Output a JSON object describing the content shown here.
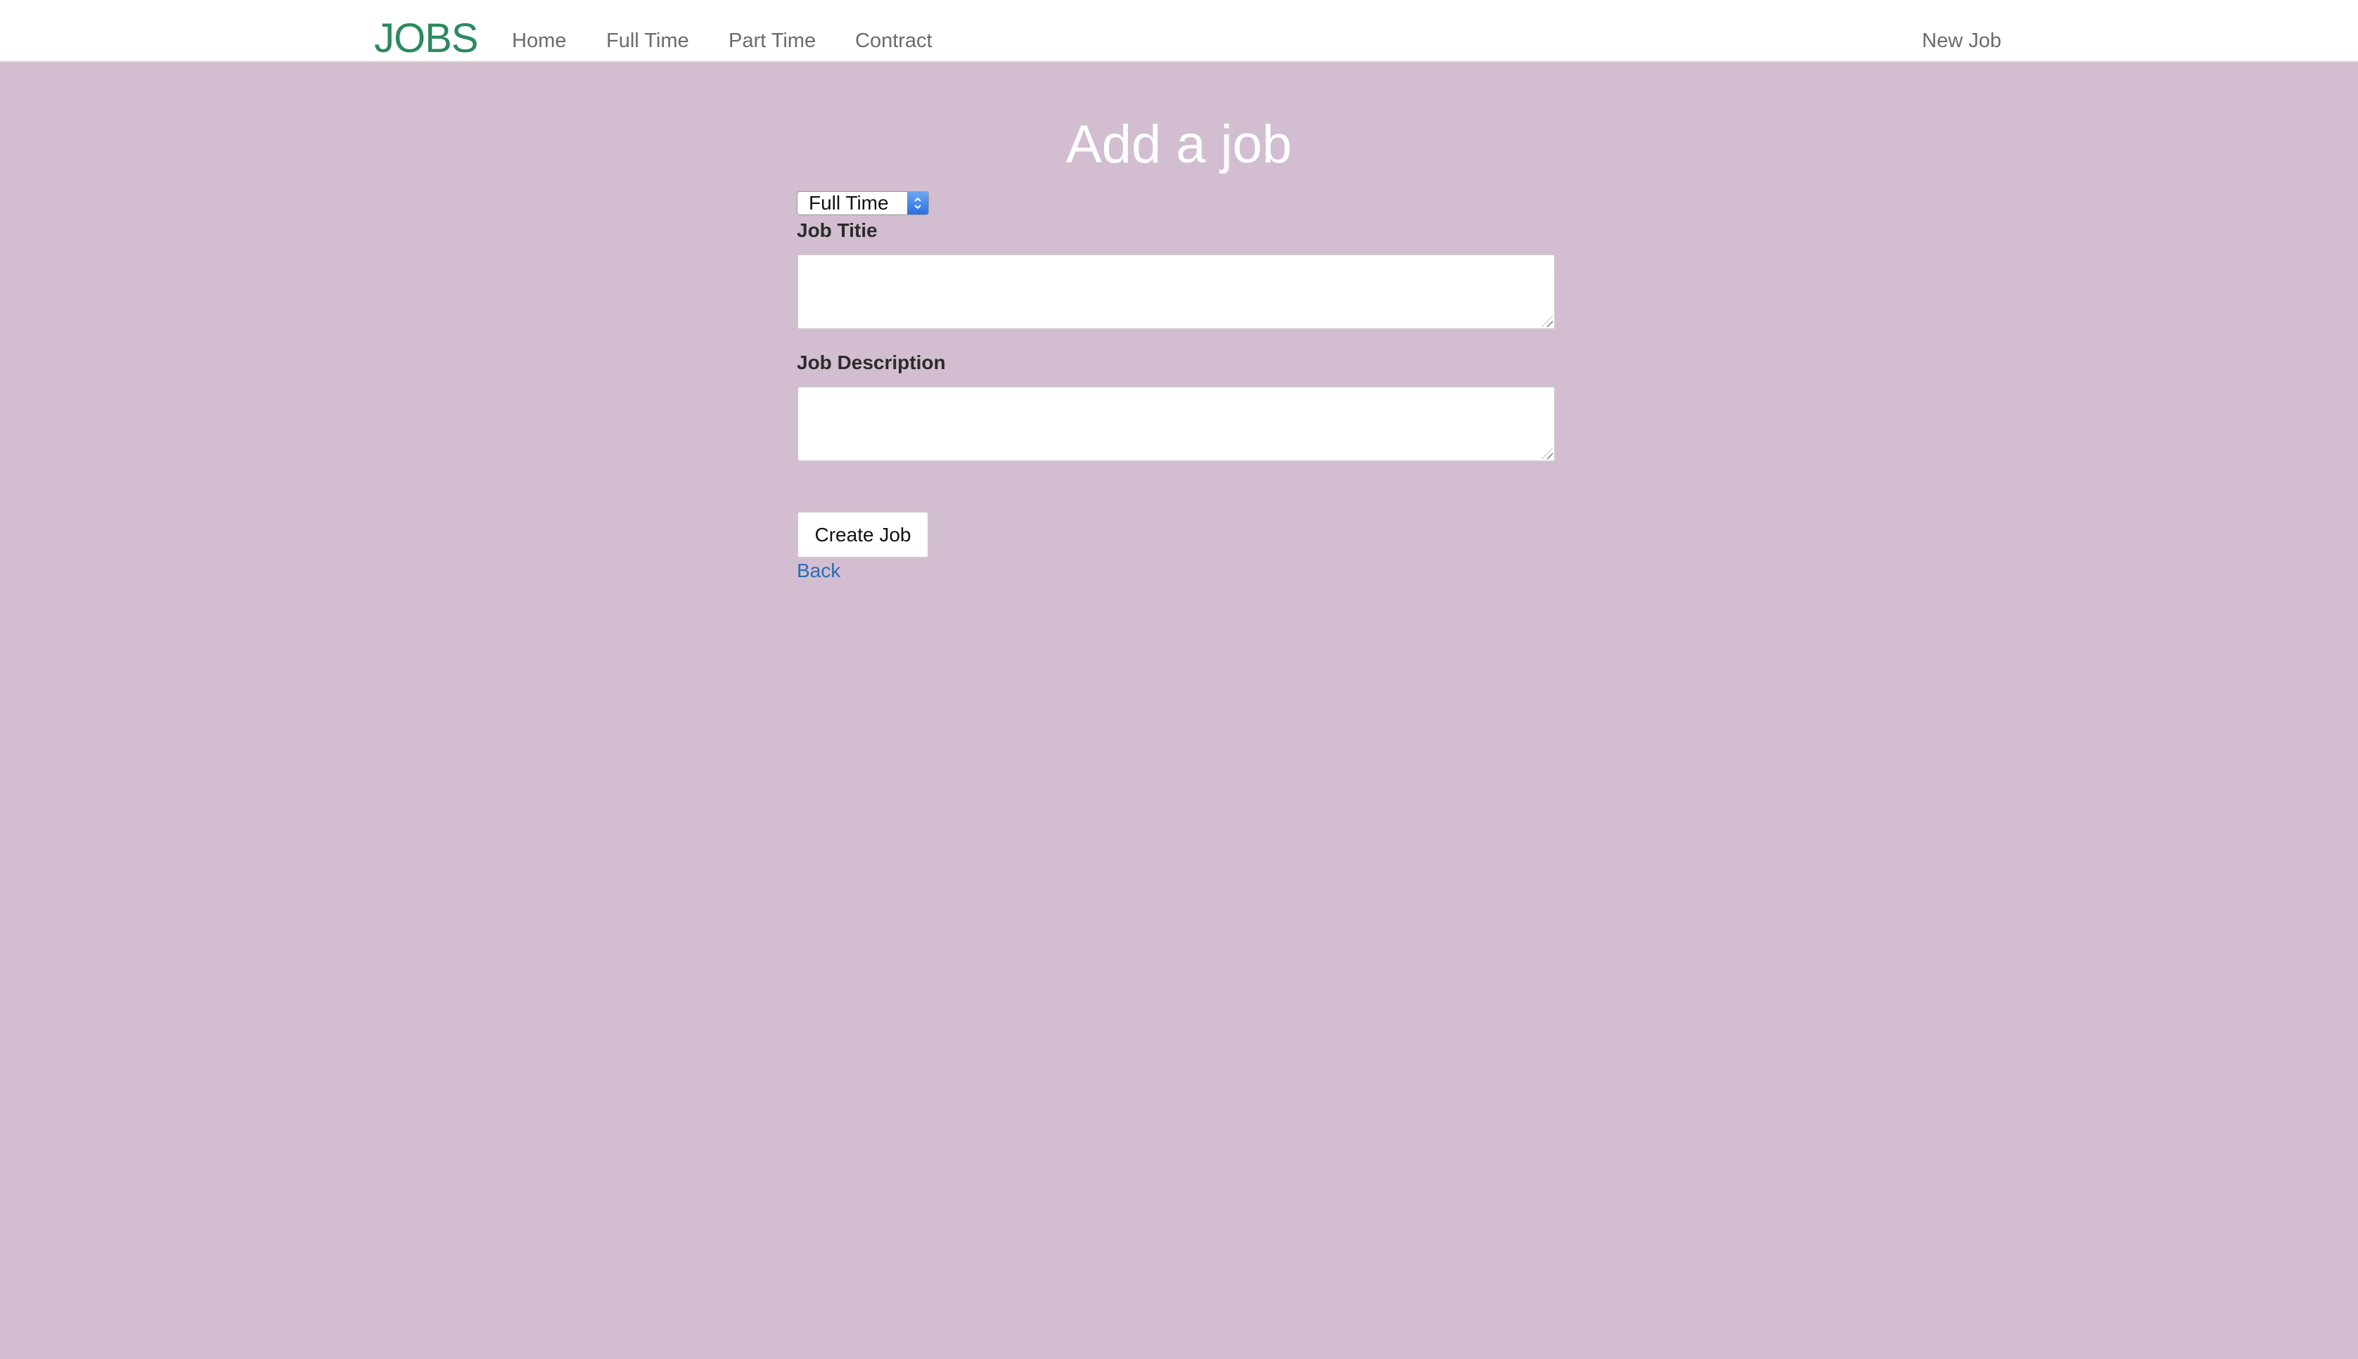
{
  "navbar": {
    "brand": "JOBS",
    "links": [
      {
        "label": "Home"
      },
      {
        "label": "Full Time"
      },
      {
        "label": "Part Time"
      },
      {
        "label": "Contract"
      }
    ],
    "right_link": "New Job"
  },
  "page": {
    "title": "Add a job"
  },
  "form": {
    "job_type": {
      "selected": "Full Time"
    },
    "job_title": {
      "label": "Job Titie",
      "value": ""
    },
    "job_description": {
      "label": "Job Description",
      "value": ""
    },
    "submit_label": "Create Job",
    "back_label": "Back"
  },
  "colors": {
    "background": "#d2bed0",
    "brand": "#2a8a5e",
    "link": "#2a6db5",
    "select_arrow": "#2b6fe0"
  }
}
